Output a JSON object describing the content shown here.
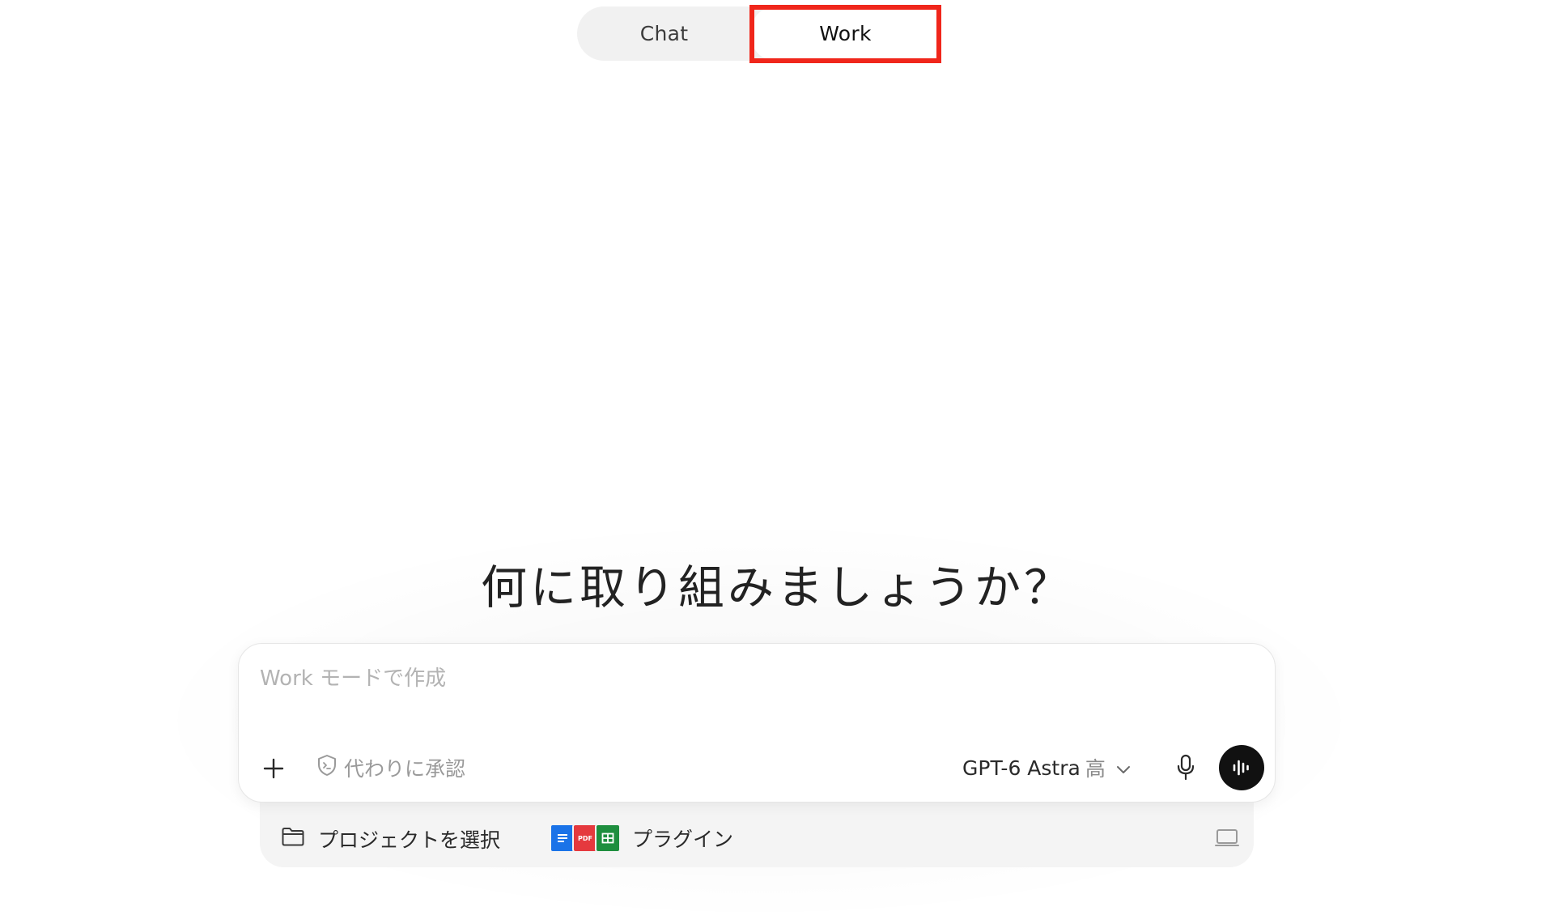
{
  "mode_toggle": {
    "tabs": [
      {
        "label": "Chat",
        "selected": false
      },
      {
        "label": "Work",
        "selected": true
      }
    ],
    "highlight_color": "#f0261b"
  },
  "main": {
    "heading": "何に取り組みましょうか？"
  },
  "composer": {
    "placeholder": "Work モードで作成",
    "value": "",
    "add_icon": "plus-icon",
    "approve_label": "代わりに承認",
    "approve_icon": "shield-icon",
    "model": {
      "name": "GPT-6 Astra",
      "effort": "高",
      "icon": "chevron-down-icon"
    },
    "mic_icon": "microphone-icon",
    "voice_icon": "voice-waveform-icon"
  },
  "footer": {
    "project_label": "プロジェクトを選択",
    "project_icon": "folder-icon",
    "plugins_label": "プラグイン",
    "plugin_icons": [
      {
        "name": "docs-icon",
        "color": "#1a73e8"
      },
      {
        "name": "pdf-icon",
        "color": "#e5393e",
        "text": "PDF"
      },
      {
        "name": "sheets-icon",
        "color": "#1e8e3e"
      }
    ],
    "device_icon": "laptop-icon"
  }
}
